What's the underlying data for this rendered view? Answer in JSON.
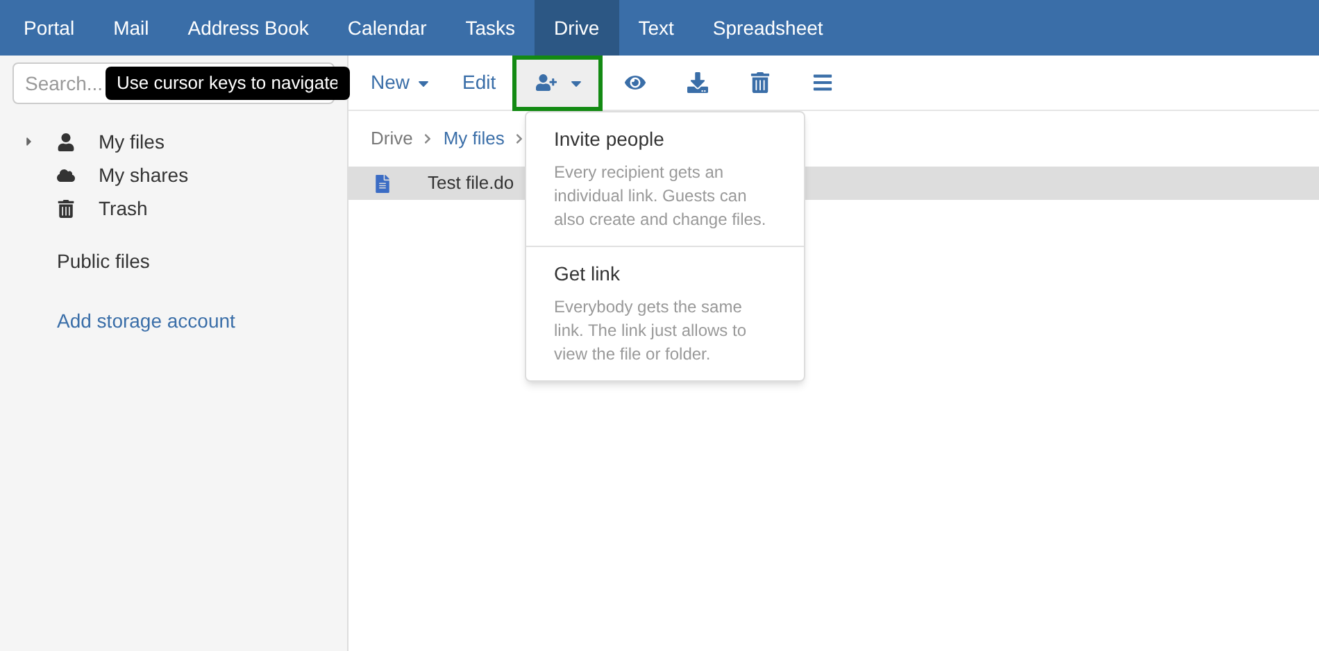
{
  "nav": [
    {
      "label": "Portal",
      "selected": false
    },
    {
      "label": "Mail",
      "selected": false
    },
    {
      "label": "Address Book",
      "selected": false
    },
    {
      "label": "Calendar",
      "selected": false
    },
    {
      "label": "Tasks",
      "selected": false
    },
    {
      "label": "Drive",
      "selected": true
    },
    {
      "label": "Text",
      "selected": false
    },
    {
      "label": "Spreadsheet",
      "selected": false
    }
  ],
  "search": {
    "placeholder": "Search..."
  },
  "tooltip": "Use cursor keys to navigate",
  "toolbar": [
    {
      "kind": "text",
      "label": "New",
      "caret": true,
      "active": false
    },
    {
      "kind": "text",
      "label": "Edit",
      "caret": false,
      "active": false
    },
    {
      "kind": "share",
      "caret": true,
      "active": true
    },
    {
      "kind": "view",
      "caret": false,
      "active": false
    },
    {
      "kind": "download",
      "caret": false,
      "active": false
    },
    {
      "kind": "delete",
      "caret": false,
      "active": false
    },
    {
      "kind": "menu",
      "caret": false,
      "active": false
    }
  ],
  "sidebar": {
    "folders": [
      {
        "label": "My files",
        "kind": "user",
        "expandable": true
      },
      {
        "label": "My shares",
        "kind": "cloud",
        "expandable": false
      },
      {
        "label": "Trash",
        "kind": "trash",
        "expandable": false
      }
    ],
    "public": "Public files",
    "add": "Add storage account"
  },
  "breadcrumb": [
    {
      "label": "Drive",
      "link": false
    },
    {
      "label": "My files",
      "link": true
    }
  ],
  "files": [
    {
      "name": "Test file.do",
      "selected": true
    }
  ],
  "dropdown": [
    {
      "title": "Invite people",
      "text": "Every recipient gets an individual link. Guests can also create and change files."
    },
    {
      "title": "Get link",
      "text": "Everybody gets the same link. The link just allows to view the file or folder."
    }
  ]
}
